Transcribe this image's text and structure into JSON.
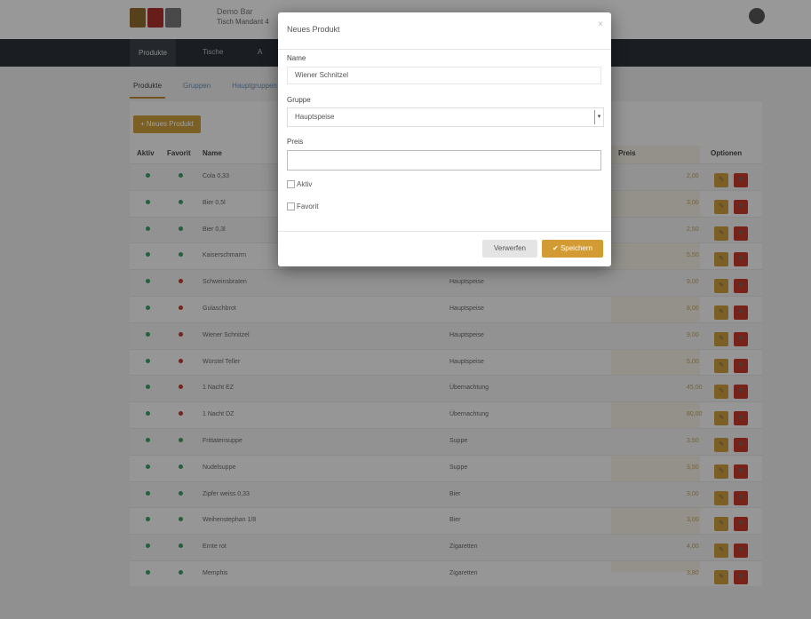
{
  "header": {
    "brand_line1": "Demo Bar",
    "brand_line2": "Tisch Mandant 4"
  },
  "nav": {
    "items": [
      "Produkte",
      "Tische",
      "A"
    ]
  },
  "subtabs": [
    "Produkte",
    "Gruppen",
    "Hauptgruppen"
  ],
  "product_list": {
    "new_button": "+ Neues Produkt",
    "columns": [
      "Aktiv",
      "Favorit",
      "Name",
      "Preis",
      "Optionen"
    ],
    "rows": [
      {
        "aktiv": "green",
        "favorit": "green",
        "name": "Cola 0,33",
        "gruppe": "",
        "preis": "2,00"
      },
      {
        "aktiv": "green",
        "favorit": "green",
        "name": "Bier 0,5l",
        "gruppe": "",
        "preis": "3,00"
      },
      {
        "aktiv": "green",
        "favorit": "green",
        "name": "Bier 0,3l",
        "gruppe": "",
        "preis": "2,50"
      },
      {
        "aktiv": "green",
        "favorit": "green",
        "name": "Kaiserschmarrn",
        "gruppe": "",
        "preis": "5,50"
      },
      {
        "aktiv": "green",
        "favorit": "red",
        "name": "Schweinsbraten",
        "gruppe": "Hauptspeise",
        "preis": "9,00"
      },
      {
        "aktiv": "green",
        "favorit": "red",
        "name": "Gulaschbrot",
        "gruppe": "Hauptspeise",
        "preis": "8,00"
      },
      {
        "aktiv": "green",
        "favorit": "red",
        "name": "Wiener Schnitzel",
        "gruppe": "Hauptspeise",
        "preis": "9,00"
      },
      {
        "aktiv": "green",
        "favorit": "red",
        "name": "Würstel Teller",
        "gruppe": "Hauptspeise",
        "preis": "5,00"
      },
      {
        "aktiv": "green",
        "favorit": "red",
        "name": "1 Nacht EZ",
        "gruppe": "Übernachtung",
        "preis": "45,00"
      },
      {
        "aktiv": "green",
        "favorit": "red",
        "name": "1 Nacht DZ",
        "gruppe": "Übernachtung",
        "preis": "80,00"
      },
      {
        "aktiv": "green",
        "favorit": "green",
        "name": "Frittatensuppe",
        "gruppe": "Suppe",
        "preis": "3,50"
      },
      {
        "aktiv": "green",
        "favorit": "green",
        "name": "Nudelsuppe",
        "gruppe": "Suppe",
        "preis": "3,50"
      },
      {
        "aktiv": "green",
        "favorit": "green",
        "name": "Zipfer weiss 0,33",
        "gruppe": "Bier",
        "preis": "3,00"
      },
      {
        "aktiv": "green",
        "favorit": "green",
        "name": "Weihenstephan 1/8",
        "gruppe": "Bier",
        "preis": "3,00"
      },
      {
        "aktiv": "green",
        "favorit": "green",
        "name": "Ernte rot",
        "gruppe": "Zigaretten",
        "preis": "4,00"
      },
      {
        "aktiv": "green",
        "favorit": "green",
        "name": "Memphis",
        "gruppe": "Zigaretten",
        "preis": "3,80"
      }
    ]
  },
  "modal": {
    "title": "Neues Produkt",
    "close": "×",
    "name_label": "Name",
    "name_value": "Wiener Schnitzel",
    "group_label": "Gruppe",
    "group_value": "Hauptspeise",
    "price_label": "Preis",
    "price_value": "",
    "checkbox_active": "Aktiv",
    "checkbox_favorite": "Favorit",
    "discard_label": "Verwerfen",
    "save_label": "✔ Speichern"
  }
}
